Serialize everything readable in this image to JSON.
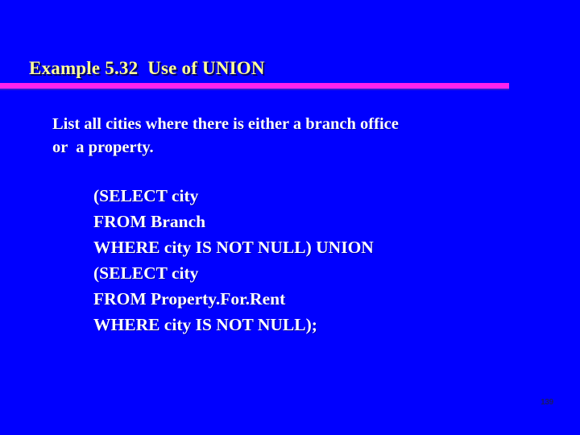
{
  "slide": {
    "background_color": "#0000ff",
    "title": "Example 5.32  Use of UNION",
    "title_color": "#ffff99",
    "rule_color": "#ff22ee",
    "body_color": "#ffffff",
    "body_lines": [
      "List all cities where there is either a branch office",
      "or  a property."
    ],
    "sql_lines": [
      "(SELECT city",
      "FROM Branch",
      "WHERE city IS NOT NULL) UNION",
      "(SELECT city",
      "FROM Property.For.Rent",
      "WHERE city IS NOT NULL);"
    ],
    "page_number": "139"
  }
}
